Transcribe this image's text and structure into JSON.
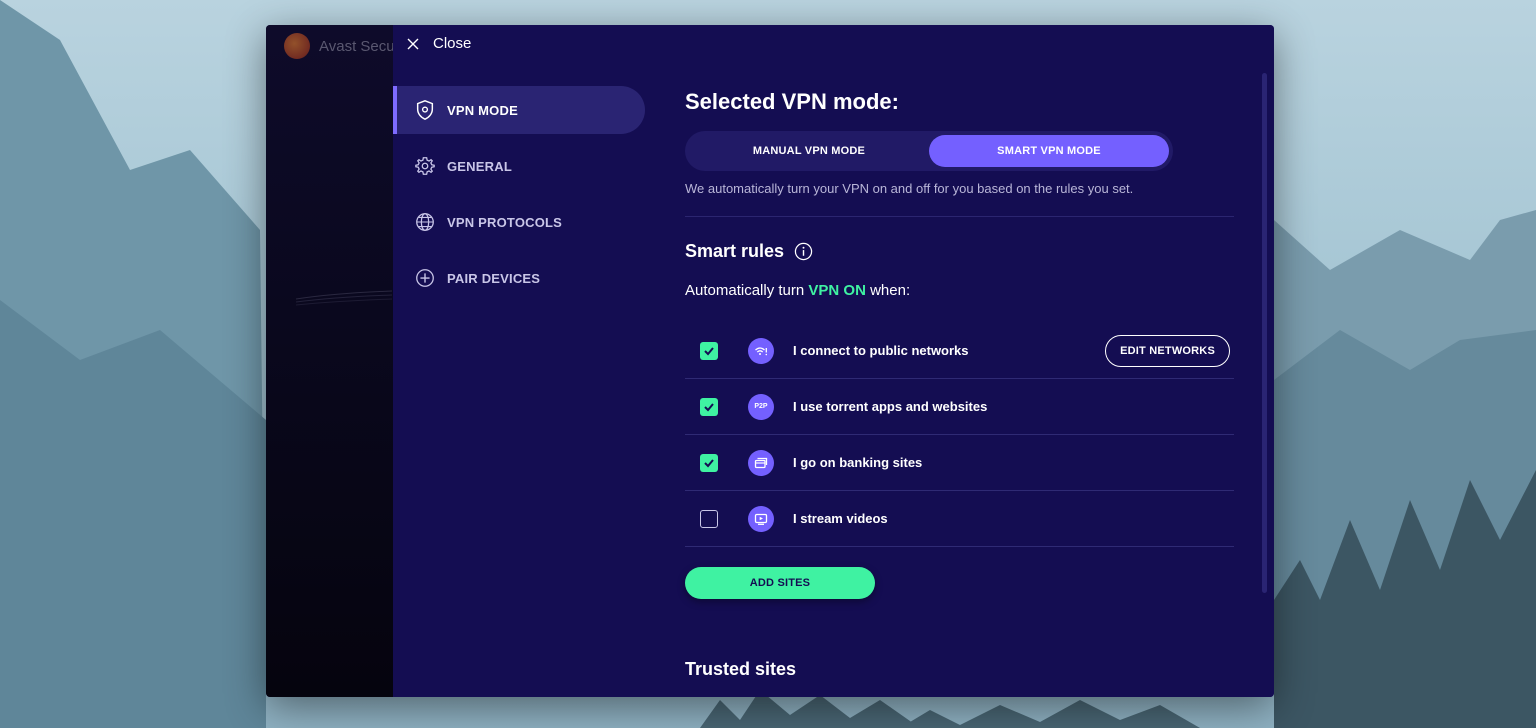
{
  "window": {
    "brand_name": "Avast Secu",
    "close_label": "Close"
  },
  "nav": {
    "items": [
      {
        "label": "VPN MODE",
        "icon": "shield-gear-icon",
        "active": true
      },
      {
        "label": "GENERAL",
        "icon": "gear-icon",
        "active": false
      },
      {
        "label": "VPN PROTOCOLS",
        "icon": "globe-icon",
        "active": false
      },
      {
        "label": "PAIR DEVICES",
        "icon": "plus-circle-icon",
        "active": false
      }
    ]
  },
  "main": {
    "title": "Selected VPN mode:",
    "modes": [
      {
        "label": "MANUAL VPN MODE",
        "selected": false
      },
      {
        "label": "SMART VPN MODE",
        "selected": true
      }
    ],
    "mode_description": "We automatically turn your VPN on and off for you based on the rules you set.",
    "smart_rules_title": "Smart rules",
    "auto_prefix": "Automatically turn",
    "auto_highlight": "VPN ON",
    "auto_suffix": "when:",
    "rules": [
      {
        "label": "I connect to public networks",
        "checked": true,
        "icon": "wifi-alert-icon"
      },
      {
        "label": "I use torrent apps and websites",
        "checked": true,
        "icon": "p2p-icon",
        "icon_text": "P2P"
      },
      {
        "label": "I go on banking sites",
        "checked": true,
        "icon": "credit-card-icon"
      },
      {
        "label": "I stream videos",
        "checked": false,
        "icon": "play-screen-icon"
      }
    ],
    "edit_networks_label": "EDIT NETWORKS",
    "add_sites_label": "ADD SITES",
    "trusted_sites_title": "Trusted sites"
  },
  "colors": {
    "panel_bg": "#140d52",
    "accent_purple": "#7460ff",
    "accent_green": "#3ff2a2"
  }
}
